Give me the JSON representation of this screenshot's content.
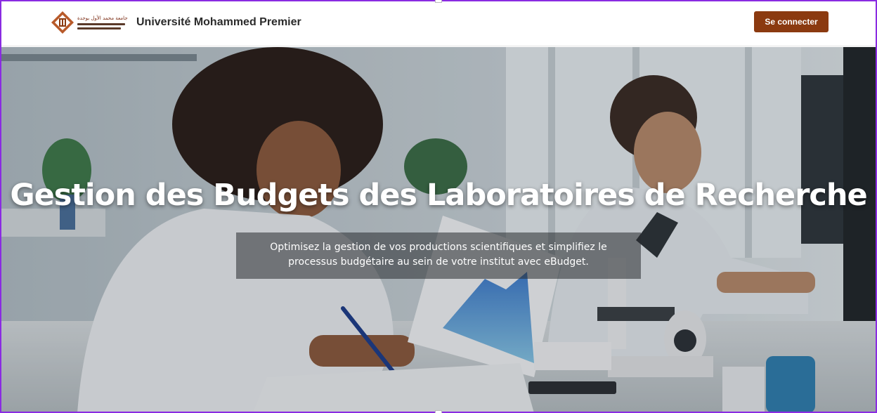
{
  "header": {
    "logo_arabic": "جامعة محمد الأول بوجدة",
    "brand_name": "Université Mohammed Premier",
    "login_label": "Se connecter"
  },
  "hero": {
    "title": "Gestion des Budgets des Laboratoires de Recherche",
    "subtitle": "Optimisez la gestion de vos productions scientifiques et simplifiez le processus budgétaire au sein de votre institut avec eBudget."
  },
  "colors": {
    "accent": "#8b3a10",
    "frame": "#8a2be2",
    "text_dark": "#2b2b2b"
  },
  "icons": [
    "university-logo-emblem"
  ]
}
